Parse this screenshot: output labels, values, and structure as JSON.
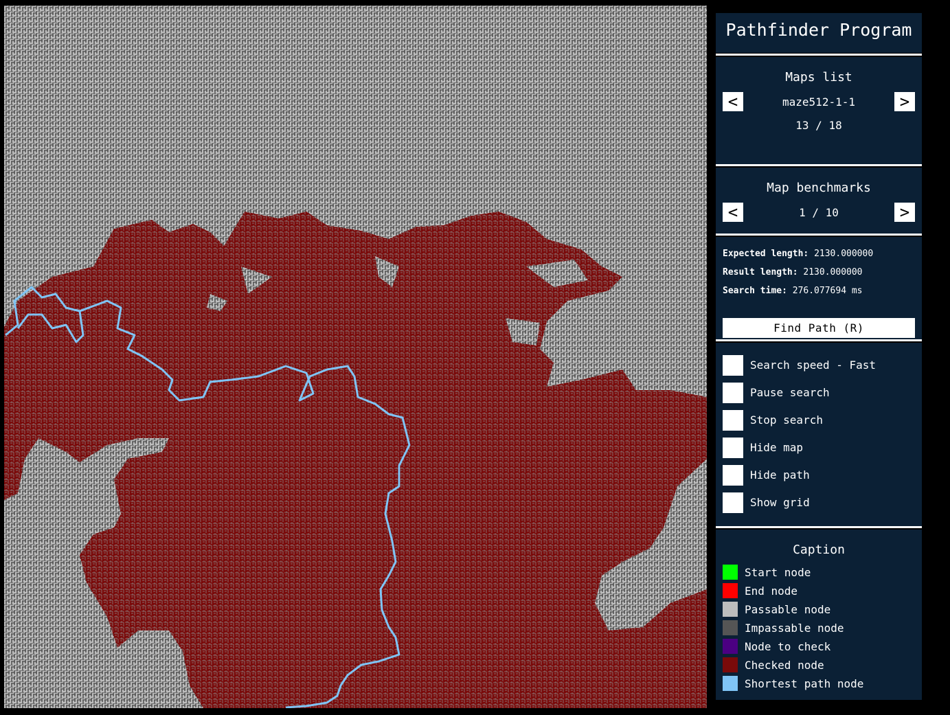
{
  "app": {
    "title": "Pathfinder Program"
  },
  "maps": {
    "heading": "Maps list",
    "name": "maze512-1-1",
    "index": "13 / 18",
    "prev_label": "<",
    "next_label": ">"
  },
  "benchmarks": {
    "heading": "Map benchmarks",
    "index": "1 / 10",
    "prev_label": "<",
    "next_label": ">"
  },
  "stats": {
    "expected_label": "Expected length:",
    "expected_value": "2130.000000",
    "result_label": "Result length:",
    "result_value": "2130.000000",
    "time_label": "Search time:",
    "time_value": "276.077694 ms"
  },
  "find_button": "Find Path (R)",
  "options": [
    {
      "label": "Search speed - Fast"
    },
    {
      "label": "Pause search"
    },
    {
      "label": "Stop search"
    },
    {
      "label": "Hide map"
    },
    {
      "label": "Hide path"
    },
    {
      "label": "Show grid"
    }
  ],
  "caption": {
    "heading": "Caption",
    "items": [
      {
        "label": "Start node",
        "color": "#00ff00"
      },
      {
        "label": "End node",
        "color": "#ff0000"
      },
      {
        "label": "Passable node",
        "color": "#bdbdbd"
      },
      {
        "label": "Impassable node",
        "color": "#555555"
      },
      {
        "label": "Node to check",
        "color": "#4b0082"
      },
      {
        "label": "Checked node",
        "color": "#7a0a0a"
      },
      {
        "label": "Shortest path node",
        "color": "#7fc4f5"
      }
    ]
  },
  "colors": {
    "panel_bg": "#0b2035",
    "passable": "#bdbdbd",
    "impassable": "#555555",
    "checked": "#7a0a0a",
    "path": "#7fc4f5"
  }
}
